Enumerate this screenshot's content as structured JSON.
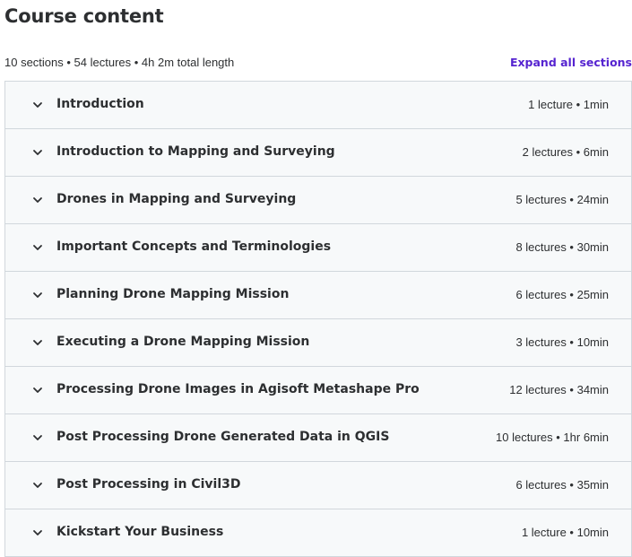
{
  "header": {
    "title": "Course content"
  },
  "summary": {
    "text": "10 sections • 54 lectures • 4h 2m total length",
    "expand_label": "Expand all sections"
  },
  "colors": {
    "accent": "#5624d0",
    "text": "#2d2f31",
    "section_bg": "#f7f9fa",
    "border": "#d1d7dc"
  },
  "sections": [
    {
      "title": "Introduction",
      "meta": "1 lecture • 1min",
      "icon": "chevron-down-icon"
    },
    {
      "title": "Introduction to Mapping and Surveying",
      "meta": "2 lectures • 6min",
      "icon": "chevron-down-icon"
    },
    {
      "title": "Drones in Mapping and Surveying",
      "meta": "5 lectures • 24min",
      "icon": "chevron-down-icon"
    },
    {
      "title": "Important Concepts and Terminologies",
      "meta": "8 lectures • 30min",
      "icon": "chevron-down-icon"
    },
    {
      "title": "Planning Drone Mapping Mission",
      "meta": "6 lectures • 25min",
      "icon": "chevron-down-icon"
    },
    {
      "title": "Executing a Drone Mapping Mission",
      "meta": "3 lectures • 10min",
      "icon": "chevron-down-icon"
    },
    {
      "title": "Processing Drone Images in Agisoft Metashape Pro",
      "meta": "12 lectures • 34min",
      "icon": "chevron-down-icon"
    },
    {
      "title": "Post Processing Drone Generated Data in QGIS",
      "meta": "10 lectures • 1hr 6min",
      "icon": "chevron-down-icon"
    },
    {
      "title": "Post Processing in Civil3D",
      "meta": "6 lectures • 35min",
      "icon": "chevron-down-icon"
    },
    {
      "title": "Kickstart Your Business",
      "meta": "1 lecture • 10min",
      "icon": "chevron-down-icon"
    }
  ]
}
